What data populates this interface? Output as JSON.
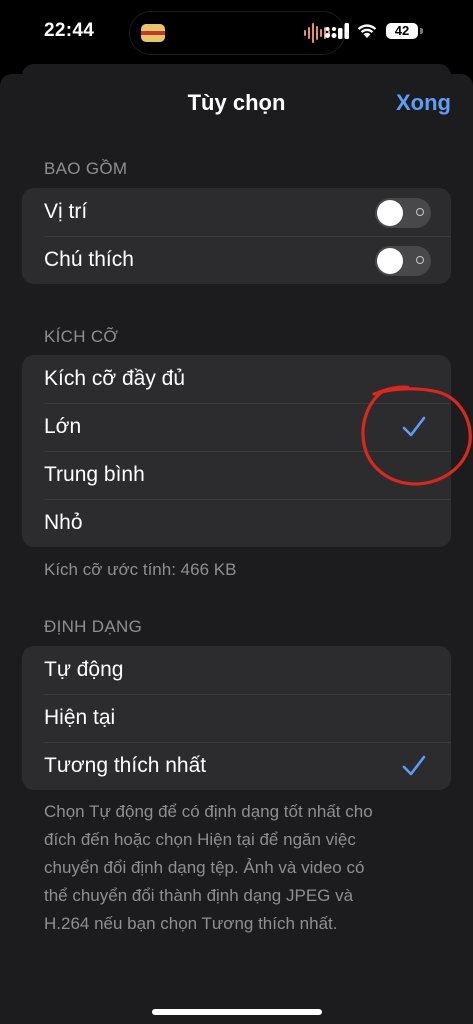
{
  "status_bar": {
    "time": "22:44",
    "battery_level": "42",
    "icons": [
      "cellular-signal-icon",
      "wifi-icon",
      "battery-icon"
    ]
  },
  "header": {
    "title": "Tùy chọn",
    "done_label": "Xong"
  },
  "include_section": {
    "header": "BAO GỒM",
    "rows": [
      {
        "label": "Vị trí",
        "toggle_on": false
      },
      {
        "label": "Chú thích",
        "toggle_on": false
      }
    ]
  },
  "size_section": {
    "header": "KÍCH CỠ",
    "rows": [
      {
        "label": "Kích cỡ đầy đủ",
        "selected": false
      },
      {
        "label": "Lớn",
        "selected": true
      },
      {
        "label": "Trung bình",
        "selected": false
      },
      {
        "label": "Nhỏ",
        "selected": false
      }
    ],
    "footer": "Kích cỡ ước tính: 466 KB"
  },
  "format_section": {
    "header": "ĐỊNH DẠNG",
    "rows": [
      {
        "label": "Tự động",
        "selected": false
      },
      {
        "label": "Hiện tại",
        "selected": false
      },
      {
        "label": "Tương thích nhất",
        "selected": true
      }
    ],
    "footer_lines": [
      "Chọn Tự động để có định dạng tốt nhất cho",
      "đích đến hoặc chọn Hiện tại để ngăn việc",
      "chuyển đổi định dạng tệp. Ảnh và video có",
      "thể chuyển đổi thành định dạng JPEG và",
      "H.264 nếu bạn chọn Tương thích nhất."
    ]
  },
  "colors": {
    "accent": "#5e9df5",
    "background": "#1c1c1e",
    "group_background": "#2c2c2e",
    "secondary_text": "#8e8e93",
    "annotation": "#d9281e"
  }
}
